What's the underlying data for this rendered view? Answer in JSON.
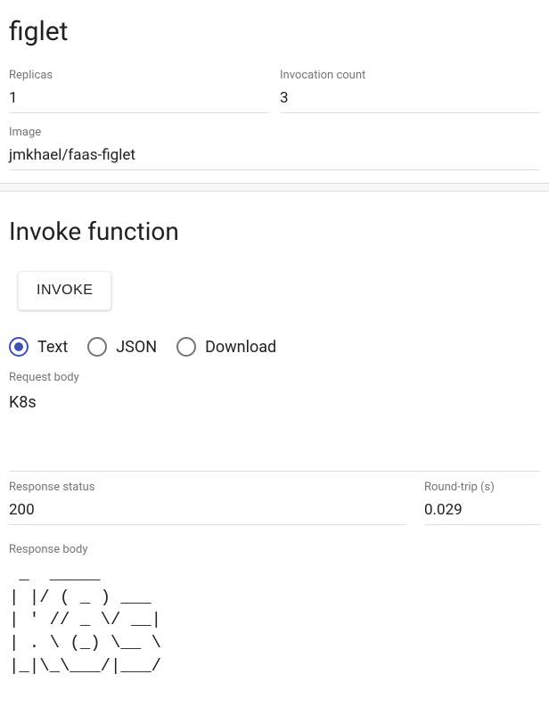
{
  "function": {
    "name": "figlet",
    "replicas_label": "Replicas",
    "replicas": "1",
    "invocation_label": "Invocation count",
    "invocation_count": "3",
    "image_label": "Image",
    "image": "jmkhael/faas-figlet"
  },
  "invoke": {
    "heading": "Invoke function",
    "button": "INVOKE",
    "mode_options": {
      "text": "Text",
      "json": "JSON",
      "download": "Download"
    },
    "selected_mode": "text",
    "request_body_label": "Request body",
    "request_body": "K8s"
  },
  "response": {
    "status_label": "Response status",
    "status": "200",
    "rtt_label": "Round-trip (s)",
    "rtt": "0.029",
    "body_label": "Response body",
    "body": " _  _____     \n| |/ ( _ ) ___ \n| ' // _ \\/ __|\n| . \\ (_) \\__ \\\n|_|\\_\\___/|___/"
  }
}
